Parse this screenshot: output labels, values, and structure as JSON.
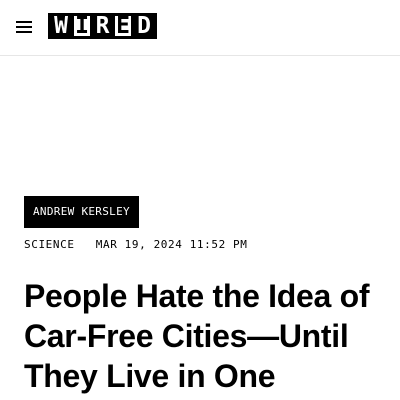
{
  "header": {
    "menu_icon": "hamburger-menu-icon",
    "logo": {
      "letters": [
        "W",
        "I",
        "R",
        "E",
        "D"
      ]
    }
  },
  "article": {
    "author": "ANDREW KERSLEY",
    "section": "SCIENCE",
    "date": "MAR 19, 2024 11:52 PM",
    "title": "People Hate the Idea of Car-Free Cities—Until They Live in One"
  }
}
